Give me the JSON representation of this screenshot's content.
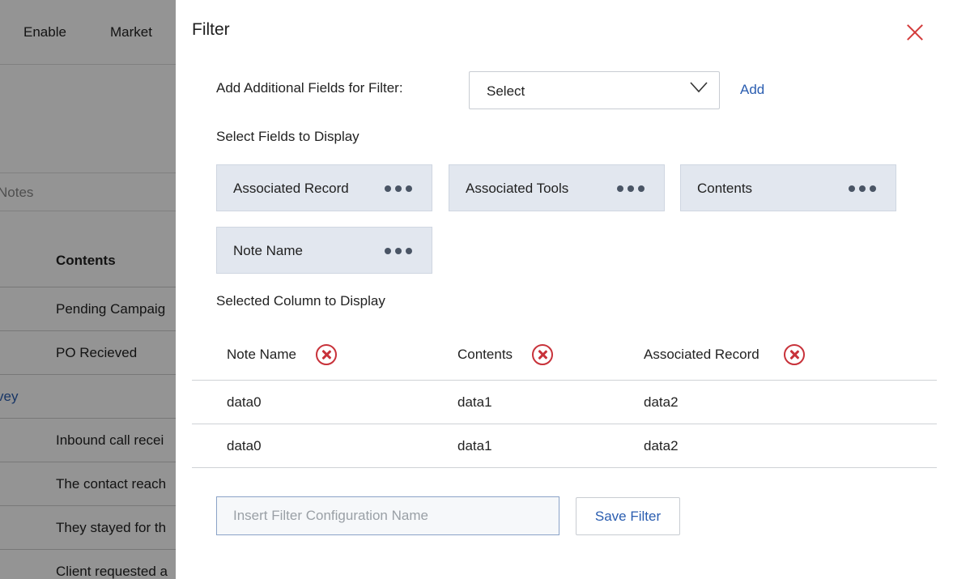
{
  "background": {
    "nav_items": [
      "Enable",
      "Market"
    ],
    "notes_tab": "Notes",
    "column_header": "Contents",
    "rows": [
      {
        "text": "Pending Campaig",
        "link": false
      },
      {
        "text": "PO Recieved",
        "link": false
      },
      {
        "text": "vey",
        "link": true
      },
      {
        "text": "Inbound call recei",
        "link": false
      },
      {
        "text": "The contact reach",
        "link": false
      },
      {
        "text": "They stayed for th",
        "link": false
      },
      {
        "text": "Client requested a",
        "link": false
      }
    ]
  },
  "filter": {
    "title": "Filter",
    "add_fields_label": "Add Additional Fields for Filter:",
    "select_value": "Select",
    "add_label": "Add",
    "select_fields_label": "Select Fields to Display",
    "fields": [
      "Associated Record",
      "Associated Tools",
      "Contents",
      "Note Name"
    ],
    "selected_columns_label": "Selected Column to Display",
    "columns": [
      "Note Name",
      "Contents",
      "Associated Record"
    ],
    "rows": [
      [
        "data0",
        "data1",
        "data2"
      ],
      [
        "data0",
        "data1",
        "data2"
      ]
    ],
    "config_placeholder": "Insert Filter Configuration Name",
    "save_label": "Save Filter"
  },
  "colors": {
    "accent": "#2a5db0",
    "danger": "#c8323a",
    "chip_bg": "#e2e7ef"
  }
}
